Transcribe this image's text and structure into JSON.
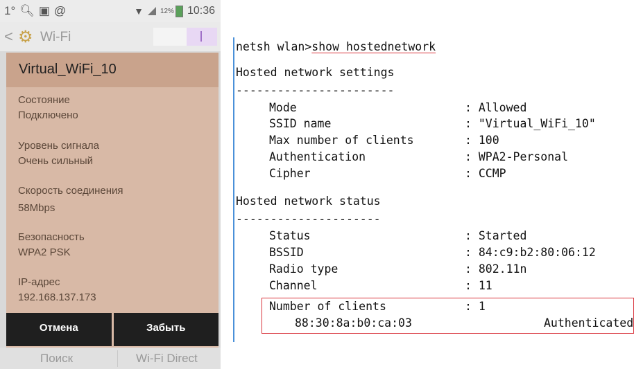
{
  "phone": {
    "statusbar": {
      "left_text": "1°",
      "battery": "12%",
      "time": "10:36"
    },
    "actionbar": {
      "back": "<",
      "title": "Wi-Fi"
    },
    "dialog": {
      "title": "Virtual_WiFi_10",
      "fields": [
        {
          "label": "Состояние",
          "value": "Подключено"
        },
        {
          "label": "Уровень сигнала",
          "value": "Очень сильный"
        },
        {
          "label": "Скорость соединения",
          "value": "58Mbps"
        },
        {
          "label": "Безопасность",
          "value": "WPA2 PSK"
        },
        {
          "label": "IP-адрес",
          "value": "192.168.137.173"
        }
      ],
      "cancel_label": "Отмена",
      "forget_label": "Забыть"
    },
    "bottombar": {
      "search_label": "Поиск",
      "direct_label": "Wi-Fi Direct"
    }
  },
  "console": {
    "prompt": "netsh wlan>",
    "command": "show hostednetwork",
    "settings_header": "Hosted network settings",
    "separator1": "-----------------------",
    "settings": [
      {
        "key": "Mode",
        "value": "Allowed"
      },
      {
        "key": "SSID name",
        "value": "\"Virtual_WiFi_10\""
      },
      {
        "key": "Max number of clients",
        "value": "100"
      },
      {
        "key": "Authentication",
        "value": "WPA2-Personal"
      },
      {
        "key": "Cipher",
        "value": "CCMP"
      }
    ],
    "status_header": "Hosted network status",
    "separator2": "---------------------",
    "status": [
      {
        "key": "Status",
        "value": "Started"
      },
      {
        "key": "BSSID",
        "value": "84:c9:b2:80:06:12"
      },
      {
        "key": "Radio type",
        "value": "802.11n"
      },
      {
        "key": "Channel",
        "value": "11"
      },
      {
        "key": "Number of clients",
        "value": "1"
      }
    ],
    "client": {
      "mac": "88:30:8a:b0:ca:03",
      "state": "Authenticated"
    }
  },
  "colors": {
    "dialog_bg": "#d8b9a6",
    "dialog_title_bg": "#c9a38c",
    "highlight": "#d9323a",
    "console_border": "#4a90d9"
  }
}
